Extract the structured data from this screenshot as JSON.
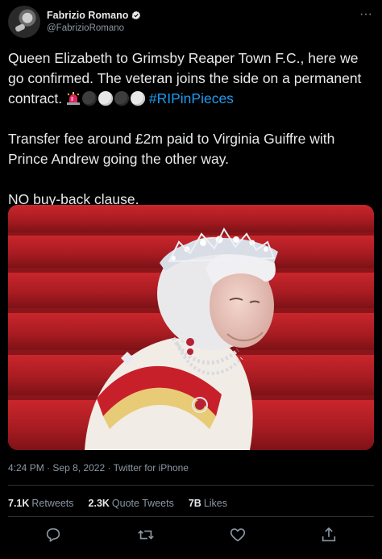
{
  "author": {
    "display_name": "Fabrizio Romano",
    "handle": "@FabrizioRomano",
    "verified": true
  },
  "tweet": {
    "line1": "Queen Elizabeth to Grimsby Reaper Town F.C., here we go confirmed. The veteran joins the side on a permanent contract.",
    "hashtag": "#RIPinPieces",
    "paragraph2": "Transfer fee around £2m paid to Virginia Guiffre with Prince Andrew going the other way.",
    "paragraph3": "NO buy-back clause.",
    "emojis": [
      "rotating-light",
      "new-moon",
      "full-moon",
      "new-moon",
      "full-moon"
    ]
  },
  "meta": {
    "time": "4:24 PM",
    "date": "Sep 8, 2022",
    "source": "Twitter for iPhone",
    "separator": "·"
  },
  "stats": {
    "retweets_value": "7.1K",
    "retweets_label": "Retweets",
    "quotes_value": "2.3K",
    "quotes_label": "Quote Tweets",
    "likes_value": "7B",
    "likes_label": "Likes"
  },
  "actions": [
    "reply-icon",
    "retweet-icon",
    "like-icon",
    "share-icon"
  ],
  "colors": {
    "background": "#000000",
    "text": "#e7e9ea",
    "muted": "#8b98a5",
    "link": "#1d9bf0",
    "divider": "#2f3336"
  }
}
